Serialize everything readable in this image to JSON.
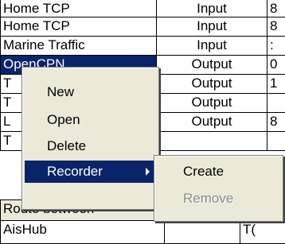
{
  "table": {
    "rows": [
      {
        "name": "Home TCP",
        "direction": "Input",
        "extra": "8"
      },
      {
        "name": "Marine Traffic",
        "direction": "Input",
        "extra": ":"
      },
      {
        "name": "OpenCPN",
        "direction": "Output",
        "extra": "0"
      },
      {
        "name": "T",
        "direction": "Output",
        "extra": "1"
      },
      {
        "name": "T",
        "direction": "Output",
        "extra": ""
      },
      {
        "name": "L",
        "direction": "Output",
        "extra": "8"
      },
      {
        "name": "T",
        "direction": "",
        "extra": ""
      }
    ],
    "section_header": "Route between",
    "bottom_row": {
      "name": "AisHub",
      "direction": "",
      "extra": "T("
    }
  },
  "context_menu": {
    "items": [
      "New",
      "Open",
      "Delete",
      "Recorder"
    ]
  },
  "submenu": {
    "items": [
      "Create",
      "Remove"
    ]
  },
  "colors": {
    "selection": "#0a246a",
    "menu_bg": "#ece9d8",
    "disabled_text": "#8a8a8a"
  }
}
